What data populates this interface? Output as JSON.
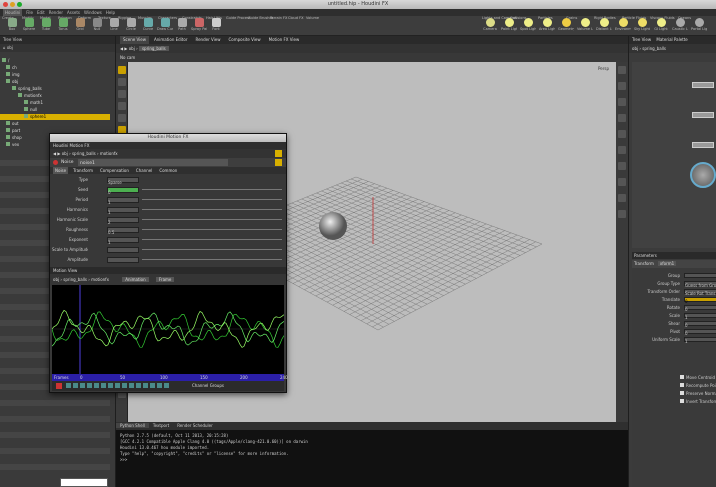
{
  "window": {
    "title": "untitled.hip - Houdini FX"
  },
  "menubar": [
    "Houdini",
    "File",
    "Edit",
    "Render",
    "Assets",
    "Windows",
    "Help"
  ],
  "shelf": {
    "tabs": [
      "Create",
      "Modify",
      "Model",
      "Polygon",
      "Deform",
      "Texture",
      "Rigging",
      "Muscles",
      "Characters",
      "Constraints",
      "Hair Utils",
      "Guide Process",
      "Guide Brushes",
      "Terrain FX",
      "Cloud FX",
      "Volume"
    ],
    "tools": [
      "Box",
      "Sphere",
      "Tube",
      "Torus",
      "Grid",
      "Null",
      "Line",
      "Circle",
      "Curve",
      "Draw Curve",
      "Path",
      "Spray Paint",
      "Font",
      "Platonic Solids",
      "L-System",
      "Metaball",
      "File"
    ],
    "right_tabs": [
      "Lights and Cameras",
      "Collisions",
      "Particles",
      "Grains",
      "Rigid Bodies",
      "Particle Fluids",
      "Viscous Fluids",
      "Oceans",
      "Fluid Containers",
      "Populate Containers",
      "Container Tools",
      "Pyro FX",
      "FEM",
      "Wires",
      "Crowds",
      "Drive Simulation"
    ],
    "right_tools": [
      "Camera",
      "Point Light",
      "Spot Light",
      "Area Light",
      "Geometry Light",
      "Volume Light",
      "Distant Light",
      "Environment Light",
      "Sky Light",
      "GI Light",
      "Caustic Light",
      "Portal Light",
      "Ambient Light",
      "Stereo Camera",
      "VR Camera",
      "Switcher"
    ]
  },
  "left_pane": {
    "path": "obj",
    "tree": [
      "/",
      "ch",
      "img",
      "obj",
      "spring_balls",
      "motionfx",
      "math1",
      "null",
      "sphere1",
      "out",
      "part",
      "shop",
      "vex"
    ],
    "selected": "sphere1"
  },
  "viewport": {
    "tabs": [
      "Scene View",
      "Animation Editor",
      "Render View",
      "Composite View",
      "Motion FX View"
    ],
    "path": "obj",
    "node": "spring_balls",
    "camera_label": "Persp",
    "view_label": "No cam"
  },
  "dialog": {
    "title": "Houdini Motion FX",
    "path": "obj",
    "node": "spring_balls",
    "sub": "motionfx",
    "op_label": "Noise",
    "op_name": "noise1",
    "tabs": [
      "Noise",
      "Transform",
      "Compensation",
      "Channel",
      "Common"
    ],
    "parms": [
      {
        "label": "Type",
        "value": "Sparse"
      },
      {
        "label": "Seed",
        "value": "0"
      },
      {
        "label": "Period",
        "value": "1"
      },
      {
        "label": "Harmonics",
        "value": "1"
      },
      {
        "label": "Harmonic Scale",
        "value": "2"
      },
      {
        "label": "Roughness",
        "value": "0.5"
      },
      {
        "label": "Exponent",
        "value": "1"
      },
      {
        "label": "Scale to Amplitude",
        "value": ""
      },
      {
        "label": "Amplitude",
        "value": ""
      }
    ],
    "motion_title": "Motion View",
    "motion_path": "obj",
    "motion_node": "spring_balls",
    "motion_sub": "motionfx",
    "motion_mode": "Animation",
    "motion_frame": "Frame",
    "timeline_label": "Frames",
    "timeline_ticks": [
      "0",
      "50",
      "100",
      "150",
      "200",
      "240"
    ],
    "channel_group": "Channel Groups"
  },
  "console": {
    "tabs": [
      "Python Shell",
      "Textport",
      "Render Scheduler"
    ],
    "lines": [
      "Python 2.7.5 (default, Oct 11 2013, 20:15:28)",
      "[GCC 4.2.1 Compatible Apple Clang 4.0 ((tags/Apple/clang-421.0.60))] on darwin",
      "Houdini 13.0.467 hou module imported.",
      "Type \"help\", \"copyright\", \"credits\" or \"license\" for more information.",
      ">>>"
    ]
  },
  "right_pane": {
    "tabs": [
      "Tree View",
      "Material Palette"
    ],
    "path": "obj",
    "node": "spring_balls",
    "parm_tabs": [
      "Network",
      "Parameters"
    ],
    "op_type": "Transform",
    "op_name": "xform1",
    "parms": [
      {
        "label": "Group",
        "value": ""
      },
      {
        "label": "Group Type",
        "value": "Guess from Group"
      },
      {
        "label": "Transform Order",
        "value": "Scale Rot Trans"
      },
      {
        "label": "Translate",
        "value": "0"
      },
      {
        "label": "Rotate",
        "value": "0"
      },
      {
        "label": "Scale",
        "value": "1"
      },
      {
        "label": "Shear",
        "value": "0"
      },
      {
        "label": "Pivot",
        "value": "0"
      },
      {
        "label": "Uniform Scale",
        "value": "1"
      }
    ],
    "checks": [
      "Move Centroid to Origin",
      "Recompute Point Normals",
      "Preserve Normal Length",
      "Invert Transformation"
    ]
  }
}
